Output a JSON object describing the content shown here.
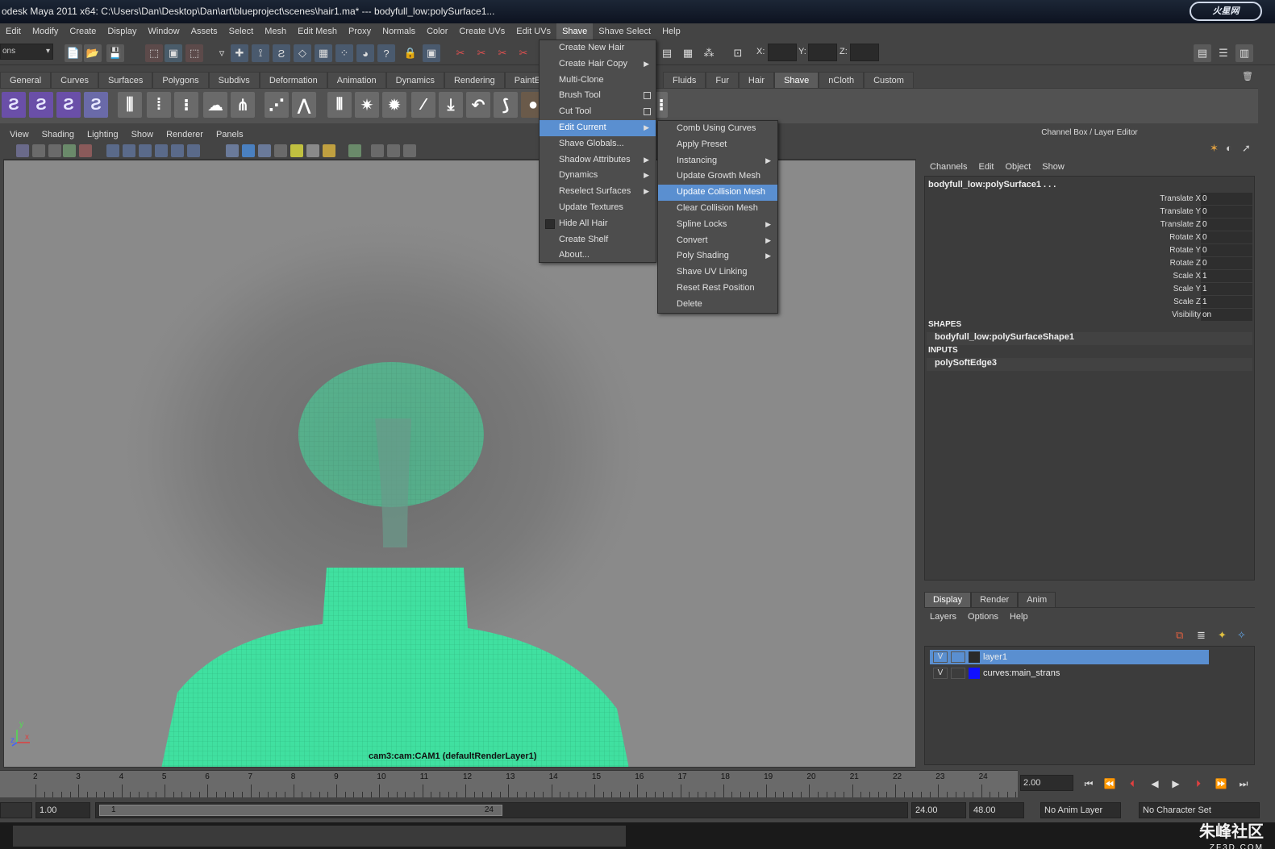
{
  "window": {
    "title": "odesk Maya 2011 x64: C:\\Users\\Dan\\Desktop\\Dan\\art\\blueproject\\scenes\\hair1.ma*   ---   bodyfull_low:polySurface1...",
    "logo": "火星网"
  },
  "menubar": [
    "Edit",
    "Modify",
    "Create",
    "Display",
    "Window",
    "Assets",
    "Select",
    "Mesh",
    "Edit Mesh",
    "Proxy",
    "Normals",
    "Color",
    "Create UVs",
    "Edit UVs",
    "Shave",
    "Shave Select",
    "Help"
  ],
  "statusline": {
    "mode_dropdown": "ons",
    "x_label": "X:",
    "y_label": "Y:",
    "z_label": "Z:"
  },
  "shelf_tabs": [
    "General",
    "Curves",
    "Surfaces",
    "Polygons",
    "Subdivs",
    "Deformation",
    "Animation",
    "Dynamics",
    "Rendering",
    "PaintEff",
    "Fluids",
    "Fur",
    "Hair",
    "Shave",
    "nCloth",
    "Custom"
  ],
  "viewport": {
    "menu": [
      "View",
      "Shading",
      "Lighting",
      "Show",
      "Renderer",
      "Panels"
    ],
    "camera_label": "cam3:cam:CAM1 (defaultRenderLayer1)",
    "axis_z": "z",
    "axis_x": "x",
    "axis_y": "y"
  },
  "shave_menu": [
    {
      "label": "Create New Hair",
      "kind": "plain"
    },
    {
      "label": "Create Hair Copy",
      "kind": "arrow"
    },
    {
      "label": "Multi-Clone",
      "kind": "plain"
    },
    {
      "label": "Brush Tool",
      "kind": "box"
    },
    {
      "label": "Cut Tool",
      "kind": "box"
    },
    {
      "label": "Edit Current",
      "kind": "arrow",
      "highlighted": true
    },
    {
      "label": "Shave Globals...",
      "kind": "plain"
    },
    {
      "label": "Shadow Attributes",
      "kind": "arrow"
    },
    {
      "label": "Dynamics",
      "kind": "arrow"
    },
    {
      "label": "Reselect Surfaces",
      "kind": "arrow"
    },
    {
      "label": "Update Textures",
      "kind": "plain"
    },
    {
      "label": "Hide All Hair",
      "kind": "check"
    },
    {
      "label": "Create Shelf",
      "kind": "plain"
    },
    {
      "label": "About...",
      "kind": "plain"
    }
  ],
  "edit_current_submenu": [
    {
      "label": "Comb Using Curves",
      "kind": "plain"
    },
    {
      "label": "Apply Preset",
      "kind": "plain"
    },
    {
      "label": "Instancing",
      "kind": "arrow"
    },
    {
      "label": "Update Growth Mesh",
      "kind": "plain"
    },
    {
      "label": "Update Collision Mesh",
      "kind": "plain",
      "highlighted": true
    },
    {
      "label": "Clear Collision Mesh",
      "kind": "plain"
    },
    {
      "label": "Spline Locks",
      "kind": "arrow"
    },
    {
      "label": "Convert",
      "kind": "arrow"
    },
    {
      "label": "Poly Shading",
      "kind": "arrow"
    },
    {
      "label": "Shave UV Linking",
      "kind": "plain"
    },
    {
      "label": "Reset Rest Position",
      "kind": "plain"
    },
    {
      "label": "Delete",
      "kind": "plain"
    }
  ],
  "channel_box": {
    "header": "Channel Box / Layer Editor",
    "menu": [
      "Channels",
      "Edit",
      "Object",
      "Show"
    ],
    "object_name": "bodyfull_low:polySurface1 . . .",
    "attributes": [
      {
        "label": "Translate X",
        "value": "0"
      },
      {
        "label": "Translate Y",
        "value": "0"
      },
      {
        "label": "Translate Z",
        "value": "0"
      },
      {
        "label": "Rotate X",
        "value": "0"
      },
      {
        "label": "Rotate Y",
        "value": "0"
      },
      {
        "label": "Rotate Z",
        "value": "0"
      },
      {
        "label": "Scale X",
        "value": "1"
      },
      {
        "label": "Scale Y",
        "value": "1"
      },
      {
        "label": "Scale Z",
        "value": "1"
      },
      {
        "label": "Visibility",
        "value": "on"
      }
    ],
    "shapes_label": "SHAPES",
    "shape_node": "bodyfull_low:polySurfaceShape1",
    "inputs_label": "INPUTS",
    "input_node": "polySoftEdge3"
  },
  "layer_editor": {
    "tabs": [
      "Display",
      "Render",
      "Anim"
    ],
    "menu": [
      "Layers",
      "Options",
      "Help"
    ],
    "layers": [
      {
        "v": "V",
        "name": "layer1",
        "color": "#2a2a2a",
        "selected": true
      },
      {
        "v": "V",
        "name": "curves:main_strans",
        "color": "#1010ff",
        "selected": false
      }
    ]
  },
  "timeline": {
    "ticks": [
      "2",
      "3",
      "4",
      "5",
      "6",
      "7",
      "8",
      "9",
      "10",
      "11",
      "12",
      "13",
      "14",
      "15",
      "16",
      "17",
      "18",
      "19",
      "20",
      "21",
      "22",
      "23",
      "24"
    ],
    "current_time": "2.00"
  },
  "range": {
    "start_field": "1.00",
    "slider_start": "1",
    "slider_end": "24",
    "end_field": "24.00",
    "max_field": "48.00",
    "anim_layer": "No Anim Layer",
    "char_set": "No Character Set"
  },
  "watermark": {
    "text": "朱峰社区",
    "sub": "ZF3D.COM"
  }
}
